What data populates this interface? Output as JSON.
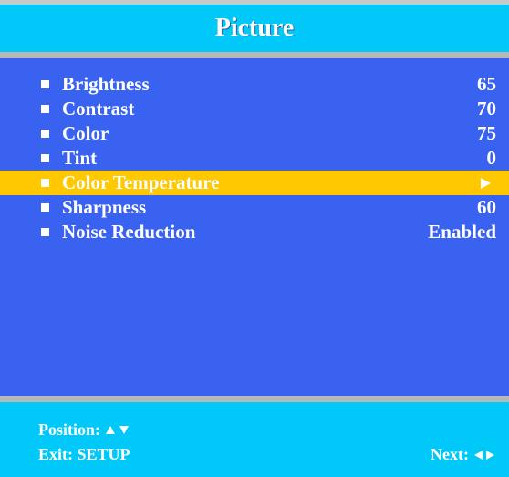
{
  "title": "Picture",
  "colors": {
    "panel": "#3a62f0",
    "header": "#00c8f8",
    "separator": "#b8b8b8",
    "selected": "#ffc800",
    "text": "#ffffff"
  },
  "menu": {
    "items": [
      {
        "label": "Brightness",
        "value": "65"
      },
      {
        "label": "Contrast",
        "value": "70"
      },
      {
        "label": "Color",
        "value": "75"
      },
      {
        "label": "Tint",
        "value": "0"
      },
      {
        "label": "Color Temperature",
        "value": "",
        "icon": "triangle-right-icon",
        "selected": true
      },
      {
        "label": "Sharpness",
        "value": "60"
      },
      {
        "label": "Noise Reduction",
        "value": "Enabled"
      }
    ]
  },
  "footer": {
    "position_label": "Position:",
    "exit_label": "Exit: SETUP",
    "next_label": "Next:"
  }
}
